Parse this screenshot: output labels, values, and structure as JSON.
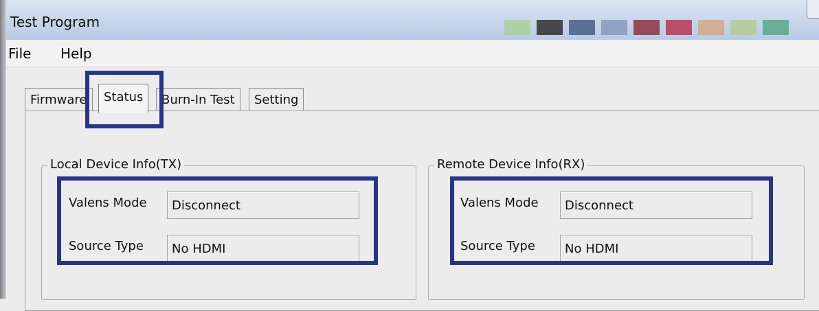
{
  "window": {
    "title": "Test Program"
  },
  "titlebar_swatches": [
    "#a8d08d",
    "#1a1a1a",
    "#3a4f7a",
    "#7f93b5",
    "#8a1c2b",
    "#b4213d",
    "#d8a07a",
    "#b5c98a",
    "#4aa37b"
  ],
  "menu": {
    "file": "File",
    "help": "Help"
  },
  "tabs": [
    {
      "label": "Firmware"
    },
    {
      "label": "Status"
    },
    {
      "label": "Burn-In Test"
    },
    {
      "label": "Setting"
    }
  ],
  "active_tab": "Status",
  "local": {
    "title": "Local Device Info(TX)",
    "valens_mode_label": "Valens Mode",
    "valens_mode_value": "Disconnect",
    "source_type_label": "Source Type",
    "source_type_value": "No HDMI"
  },
  "remote": {
    "title": "Remote Device Info(RX)",
    "valens_mode_label": "Valens Mode",
    "valens_mode_value": "Disconnect",
    "source_type_label": "Source Type",
    "source_type_value": "No HDMI"
  },
  "colors": {
    "highlight": "#27348b",
    "titlebar": "#c6d6ea",
    "window_bg": "#ececec"
  }
}
